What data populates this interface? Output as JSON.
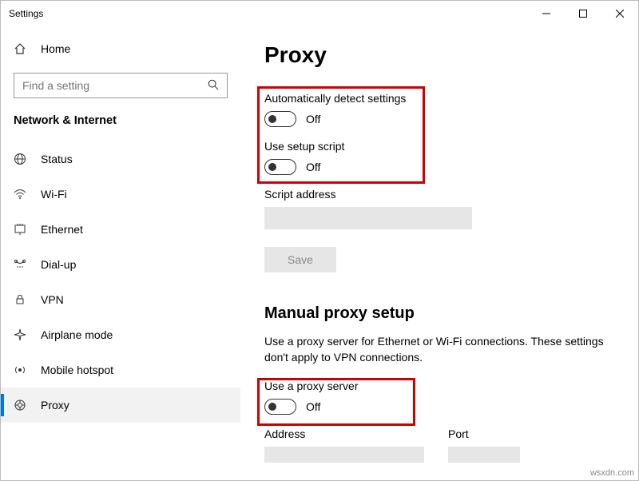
{
  "window": {
    "title": "Settings"
  },
  "nav": {
    "home": "Home",
    "search_placeholder": "Find a setting",
    "category": "Network & Internet",
    "items": [
      {
        "label": "Status"
      },
      {
        "label": "Wi-Fi"
      },
      {
        "label": "Ethernet"
      },
      {
        "label": "Dial-up"
      },
      {
        "label": "VPN"
      },
      {
        "label": "Airplane mode"
      },
      {
        "label": "Mobile hotspot"
      },
      {
        "label": "Proxy"
      }
    ]
  },
  "page": {
    "title": "Proxy",
    "auto_detect": {
      "label": "Automatically detect settings",
      "state": "Off"
    },
    "setup_script": {
      "label": "Use setup script",
      "state": "Off"
    },
    "script_address_label": "Script address",
    "save_label": "Save",
    "manual_title": "Manual proxy setup",
    "manual_desc": "Use a proxy server for Ethernet or Wi-Fi connections. These settings don't apply to VPN connections.",
    "use_proxy": {
      "label": "Use a proxy server",
      "state": "Off"
    },
    "address_label": "Address",
    "port_label": "Port"
  },
  "watermark": "wsxdn.com"
}
